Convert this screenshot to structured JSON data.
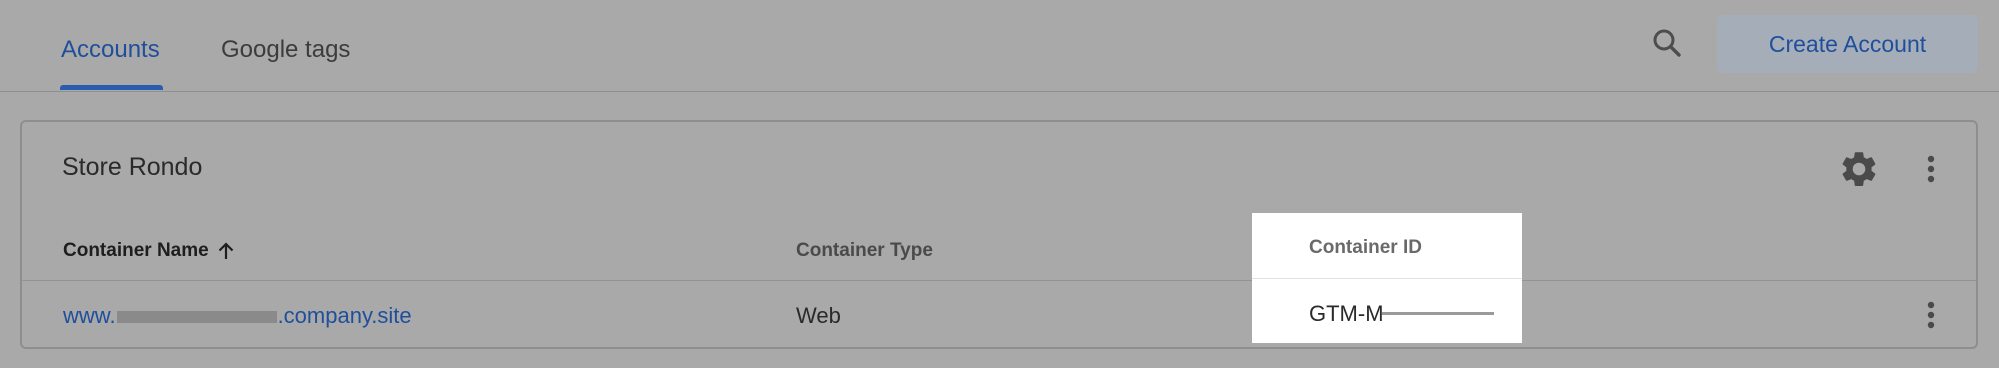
{
  "tabs": [
    {
      "label": "Accounts",
      "active": true
    },
    {
      "label": "Google tags",
      "active": false
    }
  ],
  "header": {
    "search_icon": "search-icon",
    "create_button_label": "Create Account"
  },
  "account": {
    "name": "Store Rondo",
    "settings_icon": "gear-icon",
    "more_icon": "more-vert-icon"
  },
  "table": {
    "columns": [
      {
        "label": "Container Name",
        "sort_icon": "arrow-up-icon"
      },
      {
        "label": "Container Type"
      },
      {
        "label": "Container ID"
      }
    ],
    "rows": [
      {
        "name_prefix": "www.",
        "name_suffix": ".company.site",
        "type": "Web",
        "id_visible": "GTM-M"
      }
    ]
  },
  "colors": {
    "accent": "#1f4f9c",
    "overlay_bg": "#a9a9a9",
    "highlight_bg": "#ffffff"
  }
}
